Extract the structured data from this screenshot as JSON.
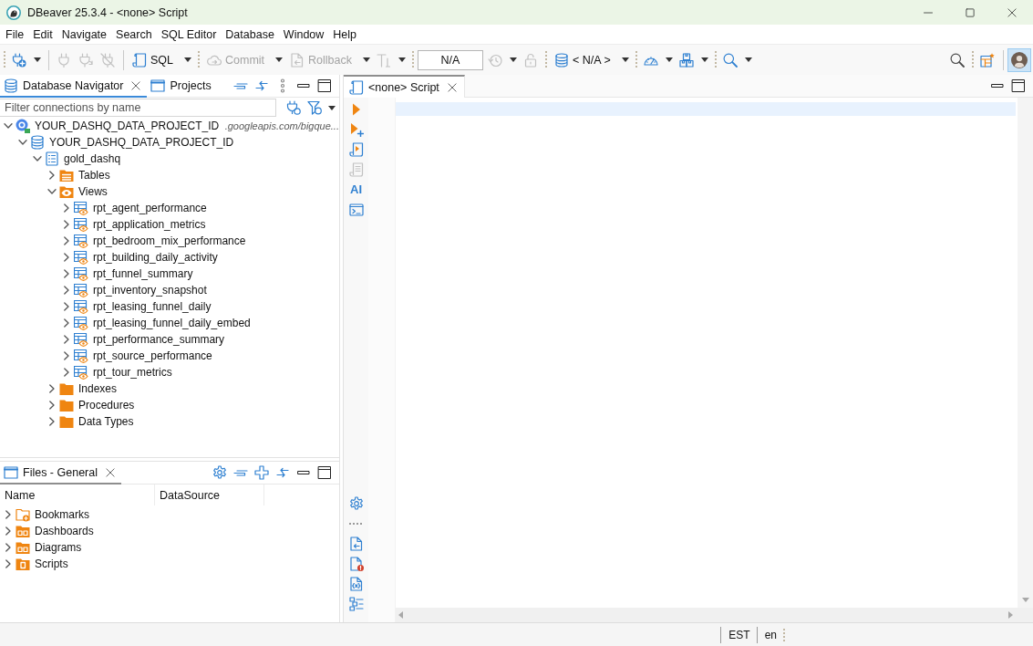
{
  "window": {
    "title": "DBeaver 25.3.4 - <none> Script"
  },
  "menu": [
    "File",
    "Edit",
    "Navigate",
    "Search",
    "SQL Editor",
    "Database",
    "Window",
    "Help"
  ],
  "toolbar": {
    "left": [
      {
        "kind": "grip"
      },
      {
        "kind": "new-connection",
        "dropdown": true,
        "disabled": false
      },
      {
        "kind": "separator"
      },
      {
        "kind": "connect",
        "dropdown": false,
        "disabled": true
      },
      {
        "kind": "reconnect",
        "dropdown": false,
        "disabled": true
      },
      {
        "kind": "disconnect",
        "dropdown": false,
        "disabled": true
      },
      {
        "kind": "separator"
      },
      {
        "kind": "sql",
        "label": "SQL",
        "dropdown": true,
        "disabled": false
      },
      {
        "kind": "grip"
      },
      {
        "kind": "commit",
        "label": "Commit",
        "dropdown": true,
        "disabled": true
      },
      {
        "kind": "rollback",
        "label": "Rollback",
        "dropdown": true,
        "disabled": true
      },
      {
        "kind": "transaction-mode",
        "dropdown": true,
        "disabled": true
      },
      {
        "kind": "grip"
      },
      {
        "kind": "field",
        "value": "N/A"
      },
      {
        "kind": "history",
        "dropdown": true,
        "disabled": true
      },
      {
        "kind": "lock",
        "dropdown": false,
        "disabled": true
      },
      {
        "kind": "grip"
      },
      {
        "kind": "datasource",
        "label": "< N/A >",
        "dropdown": true,
        "disabled": false
      },
      {
        "kind": "grip"
      },
      {
        "kind": "dashboard",
        "dropdown": true,
        "disabled": false
      },
      {
        "kind": "packages",
        "dropdown": true,
        "disabled": false
      },
      {
        "kind": "grip"
      },
      {
        "kind": "find",
        "dropdown": true,
        "disabled": false
      }
    ],
    "right": [
      {
        "kind": "search",
        "dropdown": false,
        "disabled": false
      },
      {
        "kind": "grip"
      },
      {
        "kind": "perspective",
        "dropdown": false,
        "disabled": false
      },
      {
        "kind": "separator"
      },
      {
        "kind": "avatar",
        "selected": true
      }
    ]
  },
  "navigator": {
    "focused": true,
    "tabs": [
      {
        "label": "Database Navigator",
        "kind": "navigator",
        "selected": true
      },
      {
        "label": "Projects",
        "kind": "projects",
        "selected": false
      }
    ],
    "filter": {
      "placeholder": "Filter connections by name"
    },
    "tree": [
      {
        "label": "YOUR_DASHQ_DATA_PROJECT_ID",
        "detail": ".googleapis.com/bigque...",
        "kind": "connection",
        "expanded": true,
        "children": [
          {
            "label": "YOUR_DASHQ_DATA_PROJECT_ID",
            "kind": "project",
            "expanded": true,
            "children": [
              {
                "label": "gold_dashq",
                "kind": "dataset",
                "expanded": true,
                "children": [
                  {
                    "label": "Tables",
                    "kind": "tables",
                    "expanded": false
                  },
                  {
                    "label": "Views",
                    "kind": "views",
                    "expanded": true,
                    "children": [
                      {
                        "label": "rpt_agent_performance",
                        "kind": "view",
                        "expanded": false
                      },
                      {
                        "label": "rpt_application_metrics",
                        "kind": "view",
                        "expanded": false
                      },
                      {
                        "label": "rpt_bedroom_mix_performance",
                        "kind": "view",
                        "expanded": false
                      },
                      {
                        "label": "rpt_building_daily_activity",
                        "kind": "view",
                        "expanded": false
                      },
                      {
                        "label": "rpt_funnel_summary",
                        "kind": "view",
                        "expanded": false
                      },
                      {
                        "label": "rpt_inventory_snapshot",
                        "kind": "view",
                        "expanded": false
                      },
                      {
                        "label": "rpt_leasing_funnel_daily",
                        "kind": "view",
                        "expanded": false
                      },
                      {
                        "label": "rpt_leasing_funnel_daily_embed",
                        "kind": "view",
                        "expanded": false
                      },
                      {
                        "label": "rpt_performance_summary",
                        "kind": "view",
                        "expanded": false
                      },
                      {
                        "label": "rpt_source_performance",
                        "kind": "view",
                        "expanded": false
                      },
                      {
                        "label": "rpt_tour_metrics",
                        "kind": "view",
                        "expanded": false
                      }
                    ]
                  },
                  {
                    "label": "Indexes",
                    "kind": "folder",
                    "expanded": false
                  },
                  {
                    "label": "Procedures",
                    "kind": "folder",
                    "expanded": false
                  },
                  {
                    "label": "Data Types",
                    "kind": "folder",
                    "expanded": false
                  }
                ]
              }
            ]
          }
        ]
      }
    ]
  },
  "files": {
    "focused": false,
    "tabs": [
      {
        "label": "Files - General",
        "kind": "files",
        "selected": true
      }
    ],
    "columns": [
      "Name",
      "DataSource"
    ],
    "rows": [
      {
        "label": "Bookmarks",
        "kind": "bookmarks",
        "expanded": false
      },
      {
        "label": "Dashboards",
        "kind": "dashboards",
        "expanded": false
      },
      {
        "label": "Diagrams",
        "kind": "diagrams",
        "expanded": false
      },
      {
        "label": "Scripts",
        "kind": "scripts",
        "expanded": false
      }
    ]
  },
  "editor": {
    "focused": false,
    "tabs": [
      {
        "label": "<none> Script",
        "kind": "script",
        "selected": true
      }
    ],
    "side_tools": {
      "top": [
        {
          "kind": "execute",
          "disabled": false
        },
        {
          "kind": "execute-new-tab",
          "disabled": false
        },
        {
          "kind": "execute-script",
          "disabled": false
        },
        {
          "kind": "explain",
          "disabled": true
        },
        {
          "kind": "ai",
          "label": "AI",
          "disabled": false
        },
        {
          "kind": "terminal",
          "disabled": false
        }
      ],
      "bottom": [
        {
          "kind": "settings",
          "disabled": false
        },
        {
          "kind": "export",
          "disabled": false
        },
        {
          "kind": "problems",
          "disabled": false
        },
        {
          "kind": "variables",
          "disabled": false
        },
        {
          "kind": "outline",
          "disabled": false
        }
      ]
    }
  },
  "status_bar": [
    "EST",
    "en"
  ]
}
